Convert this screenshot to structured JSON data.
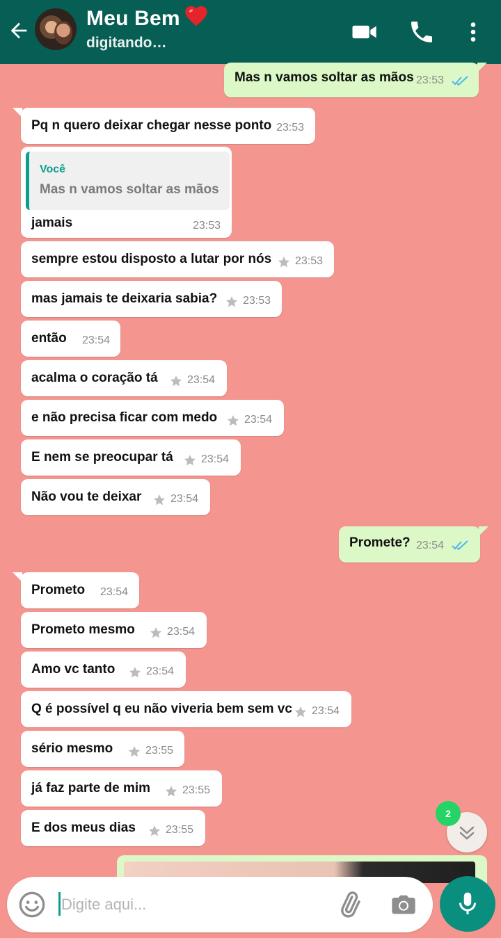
{
  "header": {
    "contact_name": "Meu Bem",
    "status": "digitando…",
    "colors": {
      "header_bg": "#075e54",
      "chat_bg": "#f4968f",
      "outgoing_bubble": "#dcf8c6",
      "incoming_bubble": "#ffffff"
    }
  },
  "messages": [
    {
      "dir": "out",
      "text": "Mas n vamos soltar as mãos",
      "time": "23:53",
      "read": true
    },
    {
      "dir": "in",
      "text": "Pq n quero deixar chegar nesse ponto",
      "time": "23:53"
    },
    {
      "dir": "in",
      "text": "jamais",
      "time": "23:53",
      "quote": {
        "author": "Você",
        "text": "Mas n vamos soltar as mãos"
      }
    },
    {
      "dir": "in",
      "text": "sempre estou disposto a lutar por nós",
      "time": "23:53",
      "starred": true
    },
    {
      "dir": "in",
      "text": "mas jamais te deixaria sabia?",
      "time": "23:53",
      "starred": true
    },
    {
      "dir": "in",
      "text": "então",
      "time": "23:54"
    },
    {
      "dir": "in",
      "text": "acalma o coração tá",
      "time": "23:54",
      "starred": true
    },
    {
      "dir": "in",
      "text": "e não precisa ficar com medo",
      "time": "23:54",
      "starred": true
    },
    {
      "dir": "in",
      "text": "E nem se preocupar tá",
      "time": "23:54",
      "starred": true
    },
    {
      "dir": "in",
      "text": "Não vou te deixar",
      "time": "23:54",
      "starred": true
    },
    {
      "dir": "out",
      "text": "Promete?",
      "time": "23:54",
      "read": true
    },
    {
      "dir": "in",
      "text": "Prometo",
      "time": "23:54"
    },
    {
      "dir": "in",
      "text": "Prometo mesmo",
      "time": "23:54",
      "starred": true
    },
    {
      "dir": "in",
      "text": "Amo vc tanto",
      "time": "23:54",
      "starred": true
    },
    {
      "dir": "in",
      "text": "Q é possível q eu não viveria bem sem vc",
      "time": "23:54",
      "starred": true
    },
    {
      "dir": "in",
      "text": "sério mesmo",
      "time": "23:55",
      "starred": true
    },
    {
      "dir": "in",
      "text": "já faz parte de mim",
      "time": "23:55",
      "starred": true
    },
    {
      "dir": "in",
      "text": "E dos meus dias",
      "time": "23:55",
      "starred": true
    }
  ],
  "scroll_badge": "2",
  "input": {
    "placeholder": "Digite aqui...",
    "value": ""
  },
  "icons": [
    "back-arrow-icon",
    "video-call-icon",
    "phone-icon",
    "more-vert-icon",
    "heart-emoji-icon",
    "star-icon",
    "double-check-icon",
    "chevron-double-down-icon",
    "emoji-icon",
    "attach-clip-icon",
    "camera-icon",
    "microphone-icon"
  ]
}
